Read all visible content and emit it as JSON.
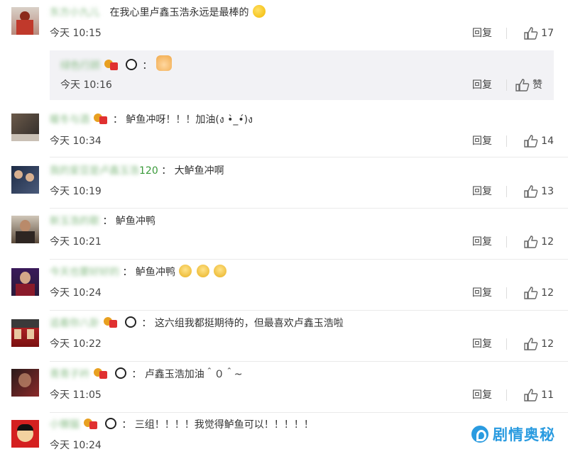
{
  "comments": [
    {
      "user": "东方小九儿",
      "text": "在我心里卢鑫玉浩永远是最棒的",
      "time": "今天 10:15",
      "reply": "回复",
      "likes": "17"
    },
    {
      "user": "绿色行顾",
      "text": "",
      "time": "今天 10:16",
      "reply": "回复",
      "likes": "赞"
    },
    {
      "user": "暖冬与酒",
      "text": "鲈鱼冲呀！！！加油(ง •̀_•́)ง",
      "time": "今天 10:34",
      "reply": "回复",
      "likes": "14"
    },
    {
      "user": "我的爱豆是卢鑫玉浩",
      "user_suffix": "120",
      "text": "大鲈鱼冲啊",
      "time": "今天 10:19",
      "reply": "回复",
      "likes": "13"
    },
    {
      "user": "新玉浩的歌",
      "text": "鲈鱼冲鸭",
      "time": "今天 10:21",
      "reply": "回复",
      "likes": "12"
    },
    {
      "user": "今天也要好好的",
      "text": "鲈鱼冲鸭",
      "time": "今天 10:24",
      "reply": "回复",
      "likes": "12"
    },
    {
      "user": "追着你八卦",
      "text": "这六组我都挺期待的，但最喜欢卢鑫玉浩啦",
      "time": "今天 10:22",
      "reply": "回复",
      "likes": "12"
    },
    {
      "user": "青青子衿",
      "text": "卢鑫玉浩加油＾０＾~",
      "time": "今天 11:05",
      "reply": "回复",
      "likes": "11"
    },
    {
      "user": "小懒猫",
      "text": "三组！！！！我觉得鲈鱼可以！！！！！",
      "time": "今天 10:24",
      "reply": "回复",
      "likes": ""
    }
  ],
  "watermark": "剧情奥秘",
  "colors": {
    "username": "#3a9a3a",
    "bg_reply": "#f2f2f5",
    "watermark": "#2a9be0"
  }
}
